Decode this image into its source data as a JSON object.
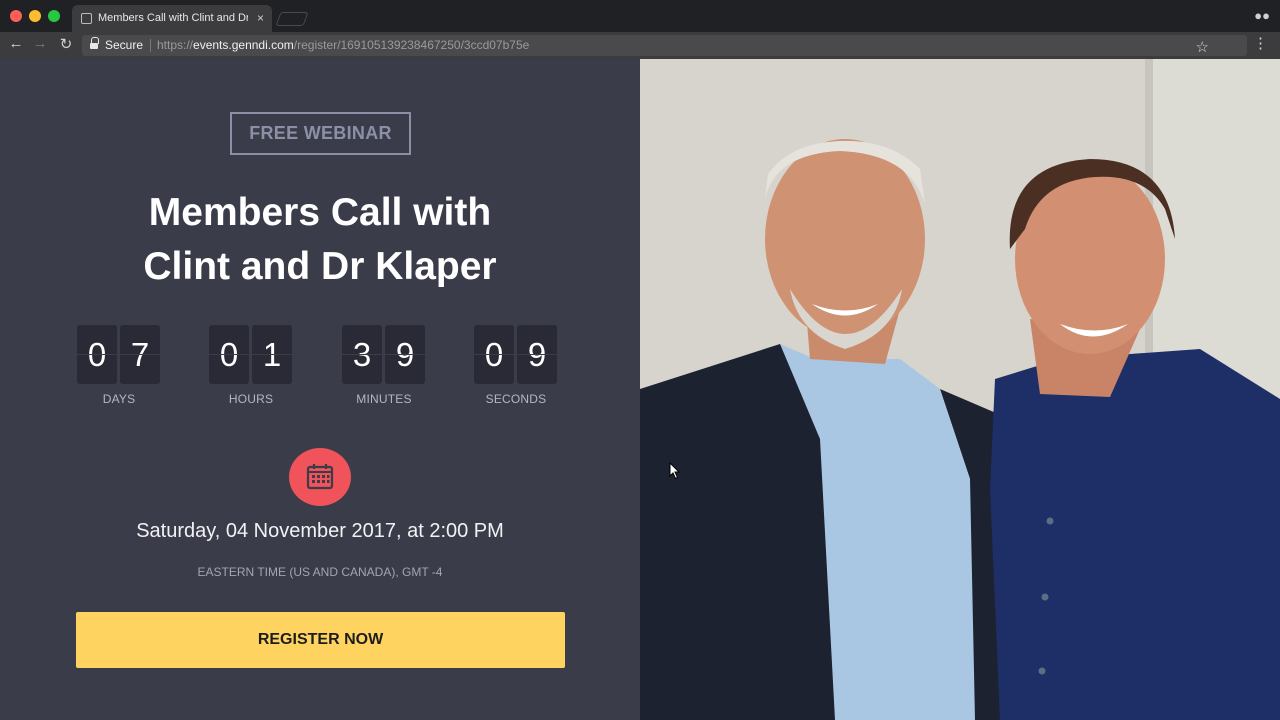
{
  "browser": {
    "tab_title": "Members Call with Clint and Dr",
    "tab_close": "×",
    "secure_label": "Secure",
    "url_scheme": "https://",
    "url_host": "events.genndi.com",
    "url_path": "/register/169105139238467250/3ccd07b75e",
    "icons": [
      "back-arrow-icon",
      "forward-arrow-icon",
      "reload-icon",
      "lock-icon",
      "star-icon",
      "menu-icon",
      "incognito-icon"
    ]
  },
  "webinar": {
    "badge": "FREE WEBINAR",
    "title_line1": "Members Call with",
    "title_line2": "Clint and Dr Klaper",
    "countdown": {
      "days": [
        "0",
        "7"
      ],
      "hours": [
        "0",
        "1"
      ],
      "minutes": [
        "3",
        "9"
      ],
      "seconds": [
        "0",
        "9"
      ],
      "labels": {
        "days": "DAYS",
        "hours": "HOURS",
        "minutes": "MINUTES",
        "seconds": "SECONDS"
      }
    },
    "calendar_icon": "calendar-icon",
    "date": "Saturday, 04 November 2017, at 2:00 PM",
    "timezone": "EASTERN TIME (US AND CANADA), GMT -4",
    "cta": "REGISTER NOW",
    "colors": {
      "panel": "#3b3c4a",
      "badge": "#8c90a6",
      "accent_red": "#f0535a",
      "cta_yellow": "#ffd35f"
    }
  }
}
